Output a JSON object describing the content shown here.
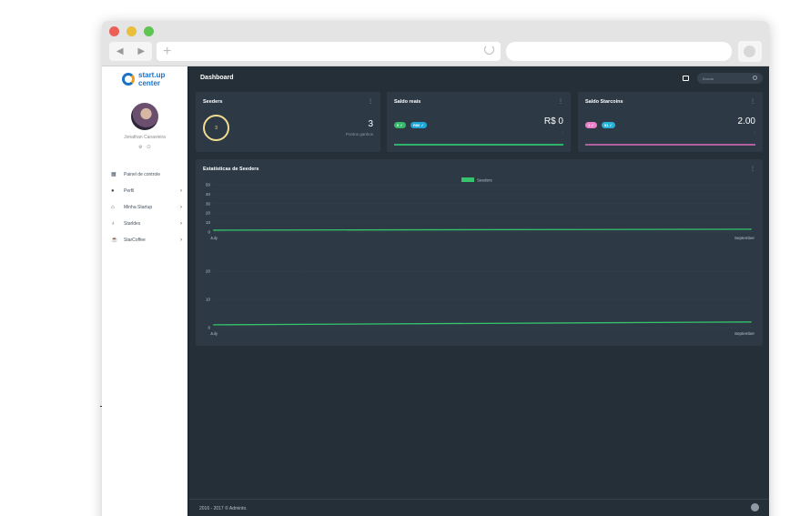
{
  "browser": {
    "nav_back": "◀",
    "nav_forward": "▶",
    "new_tab": "+"
  },
  "sidebar": {
    "logo_line1": "start.up",
    "logo_line2": "center",
    "username": "Jonathan Canavieira",
    "items": [
      {
        "label": "Painel de controle",
        "icon": "dashboard-icon",
        "glyph": "▦",
        "chevron": ""
      },
      {
        "label": "Perfil",
        "icon": "user-icon",
        "glyph": "●",
        "chevron": "›"
      },
      {
        "label": "Minha Startup",
        "icon": "home-icon",
        "glyph": "⌂",
        "chevron": "›"
      },
      {
        "label": "Starldes",
        "icon": "lightbulb-icon",
        "glyph": "♁",
        "chevron": "›"
      },
      {
        "label": "StarCoffee",
        "icon": "coffee-icon",
        "glyph": "☕",
        "chevron": "›"
      }
    ]
  },
  "header": {
    "title": "Dashboard",
    "search_placeholder": "Buscar"
  },
  "cards": {
    "seeders": {
      "title": "Seeders",
      "ring_value": "3",
      "count": "3",
      "subtitle": "Pontos ganhos"
    },
    "saldo_reais": {
      "title": "Saldo reais",
      "pill1": "0 ✓",
      "pill2": "R$0 ✓",
      "balance": "R$ 0",
      "sub": "-",
      "bar_color": "#2fb36a",
      "bar_fraction": 1.0
    },
    "saldo_starcoins": {
      "title": "Saldo Starcoins",
      "pill1": "1 ✓",
      "pill2": "$1 ✓",
      "balance": "2.00",
      "sub": "-",
      "bar_color": "#b25fa0",
      "bar_fraction": 1.0
    }
  },
  "chart_section": {
    "title": "Estatísticas de Seeders",
    "menu": "⋮"
  },
  "chart_data": [
    {
      "type": "line",
      "x": [
        "July",
        "September"
      ],
      "series": [
        {
          "name": "Seeders",
          "values": [
            2,
            3
          ],
          "color": "#35c46b"
        }
      ],
      "yticks": [
        0,
        10,
        20,
        30,
        40,
        50
      ],
      "ylim": [
        0,
        50
      ],
      "legend": "top-center",
      "grid": true
    },
    {
      "type": "line",
      "x": [
        "July",
        "September"
      ],
      "series": [
        {
          "name": "Seeders",
          "values": [
            1,
            2
          ],
          "color": "#35c46b"
        }
      ],
      "yticks": [
        0,
        10,
        20
      ],
      "ylim": [
        0,
        30
      ],
      "grid": true
    }
  ],
  "footer": {
    "text": "2016 - 2017 © Adminto."
  }
}
